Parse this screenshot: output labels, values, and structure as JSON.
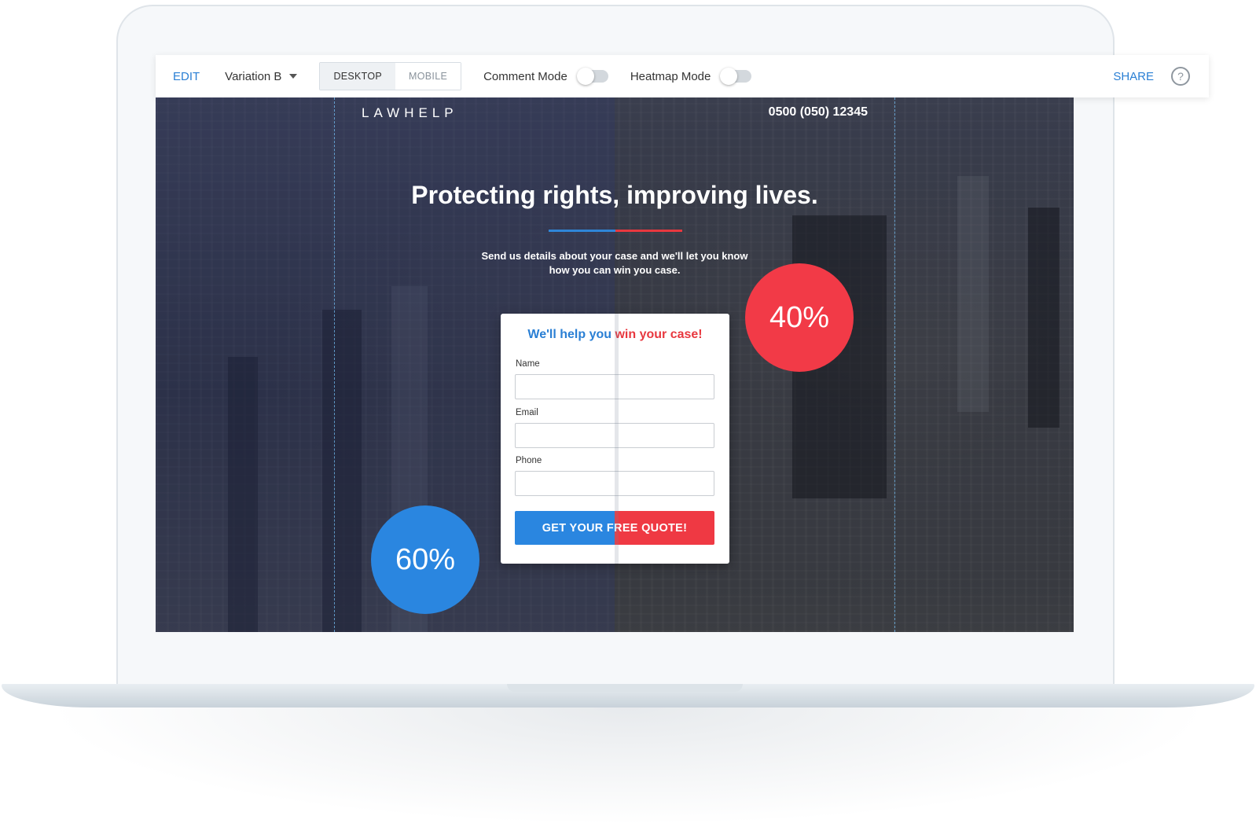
{
  "toolbar": {
    "edit_label": "EDIT",
    "variation_label": "Variation B",
    "view_modes": [
      {
        "label": "DESKTOP",
        "active": true
      },
      {
        "label": "MOBILE",
        "active": false
      }
    ],
    "comment_mode_label": "Comment Mode",
    "comment_mode_on": false,
    "heatmap_mode_label": "Heatmap Mode",
    "heatmap_mode_on": false,
    "share_label": "SHARE",
    "help_icon": "question-circle-icon",
    "help_glyph": "?"
  },
  "page": {
    "logo": "LAWHELP",
    "phone": "0500 (050) 12345",
    "headline": "Protecting rights, improving lives.",
    "subtext_line1": "Send us details about your case and we'll let you know",
    "subtext_line2": "how you can win you case."
  },
  "form": {
    "title_part1": "We'll help you",
    "title_part2": "win your case!",
    "fields": [
      {
        "label": "Name",
        "value": ""
      },
      {
        "label": "Email",
        "value": ""
      },
      {
        "label": "Phone",
        "value": ""
      }
    ],
    "cta_label": "GET YOUR FREE QUOTE!"
  },
  "split_test": {
    "variant_a_share": "60%",
    "variant_b_share": "40%"
  },
  "colors": {
    "accent_blue": "#2a86e0",
    "accent_red": "#f23a47",
    "link_blue": "#2a7fd4"
  }
}
